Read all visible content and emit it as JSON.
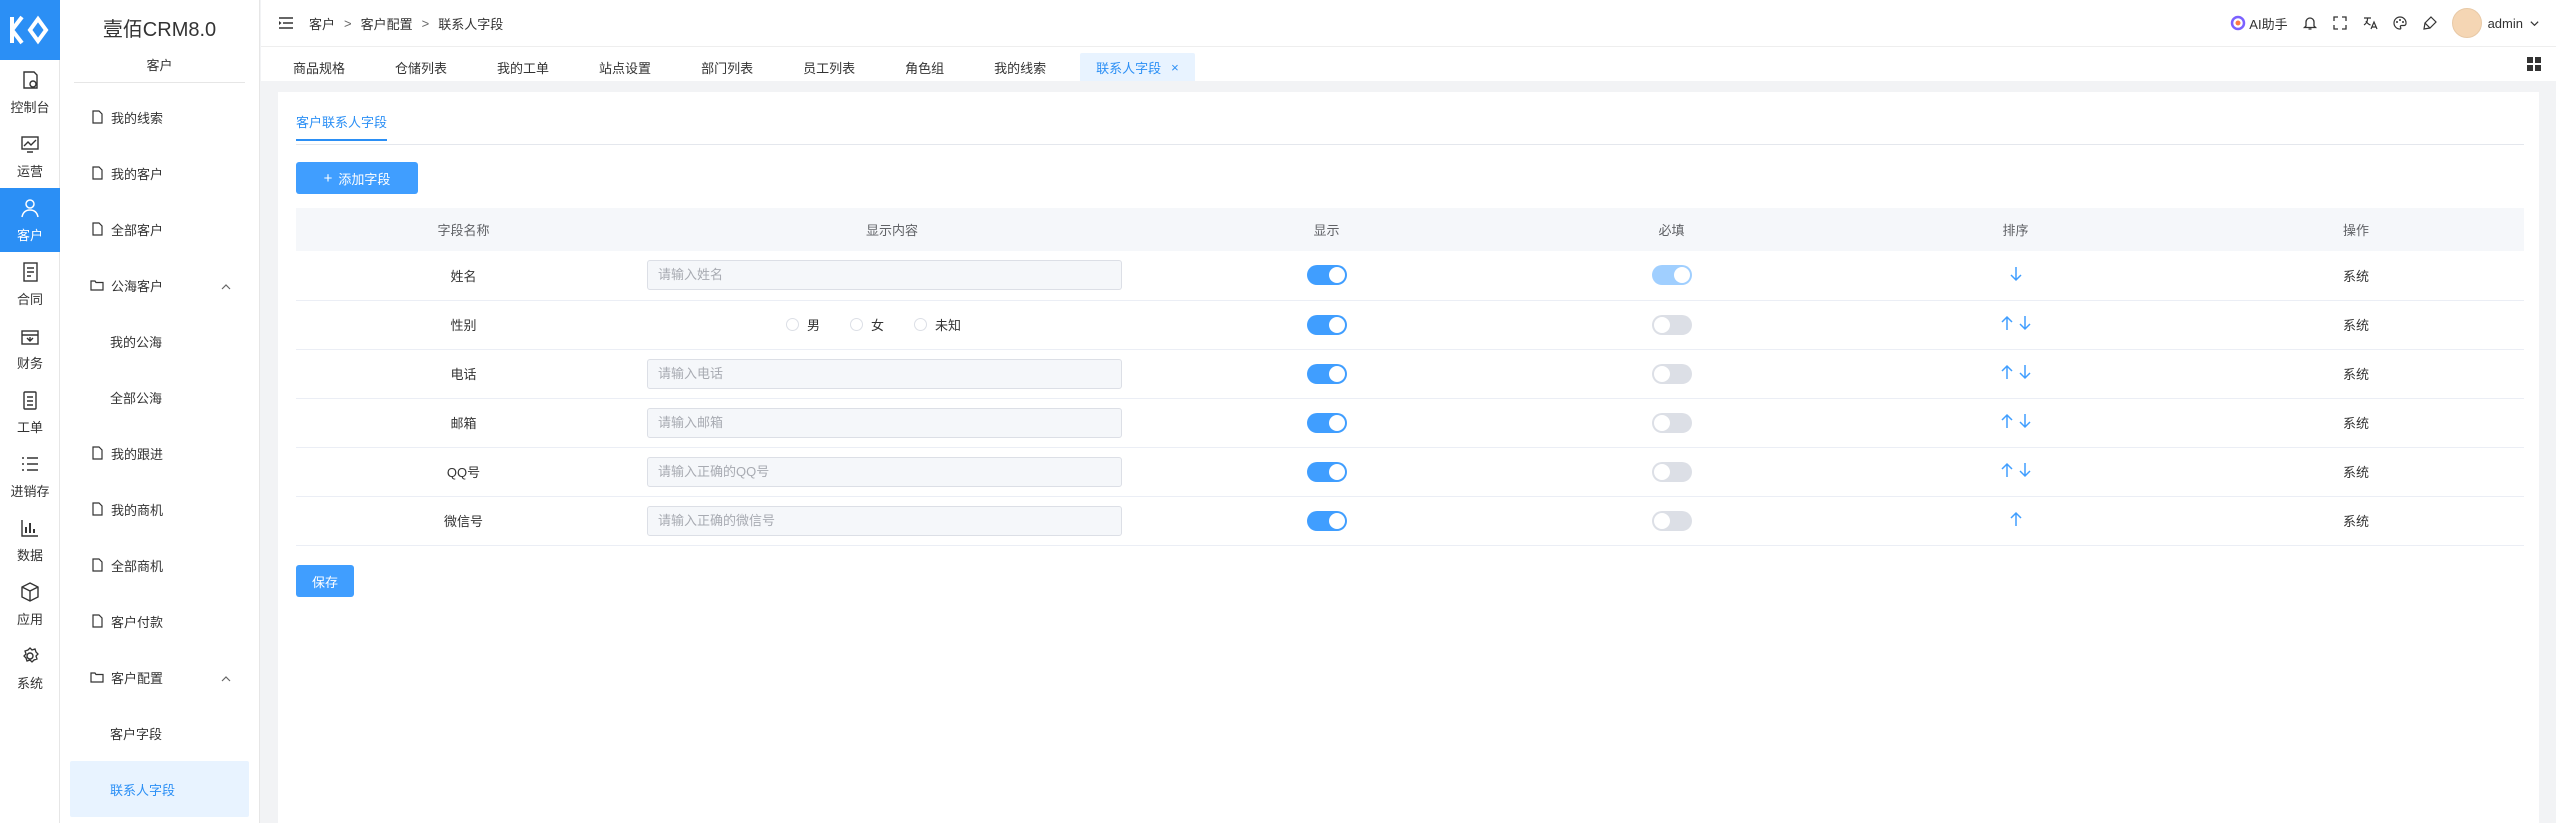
{
  "app": {
    "title": "壹佰CRM8.0",
    "module": "客户"
  },
  "rail": [
    {
      "label": "控制台",
      "icon": "dashboard-icon",
      "active": false
    },
    {
      "label": "运营",
      "icon": "chart-icon",
      "active": false
    },
    {
      "label": "客户",
      "icon": "user-icon",
      "active": true
    },
    {
      "label": "合同",
      "icon": "contract-icon",
      "active": false
    },
    {
      "label": "财务",
      "icon": "finance-icon",
      "active": false
    },
    {
      "label": "工单",
      "icon": "ticket-icon",
      "active": false
    },
    {
      "label": "进销存",
      "icon": "list-icon",
      "active": false
    },
    {
      "label": "数据",
      "icon": "bar-chart-icon",
      "active": false
    },
    {
      "label": "应用",
      "icon": "cube-icon",
      "active": false
    },
    {
      "label": "系统",
      "icon": "settings-icon",
      "active": false
    }
  ],
  "sidebar": {
    "items": [
      {
        "label": "我的线索",
        "type": "page"
      },
      {
        "label": "我的客户",
        "type": "page"
      },
      {
        "label": "全部客户",
        "type": "page"
      },
      {
        "label": "公海客户",
        "type": "folder"
      },
      {
        "label": "我的公海",
        "type": "child"
      },
      {
        "label": "全部公海",
        "type": "child"
      },
      {
        "label": "我的跟进",
        "type": "page"
      },
      {
        "label": "我的商机",
        "type": "page"
      },
      {
        "label": "全部商机",
        "type": "page"
      },
      {
        "label": "客户付款",
        "type": "page"
      },
      {
        "label": "客户配置",
        "type": "folder"
      },
      {
        "label": "客户字段",
        "type": "child"
      },
      {
        "label": "联系人字段",
        "type": "child-active"
      }
    ]
  },
  "header": {
    "breadcrumb": [
      "客户",
      "客户配置",
      "联系人字段"
    ],
    "ai_label": "AI助手",
    "user": "admin"
  },
  "tabs": [
    "商品规格",
    "仓储列表",
    "我的工单",
    "站点设置",
    "部门列表",
    "员工列表",
    "角色组",
    "我的线索",
    "联系人字段"
  ],
  "main": {
    "subtab": "客户联系人字段",
    "add_button": "添加字段",
    "save_button": "保存",
    "columns": [
      "字段名称",
      "显示内容",
      "显示",
      "必填",
      "排序",
      "操作"
    ],
    "rows": [
      {
        "name": "姓名",
        "kind": "input",
        "placeholder": "请输入姓名",
        "show": true,
        "required": true,
        "required_disabled": true,
        "sort": [
          "down"
        ],
        "op": "系统"
      },
      {
        "name": "性别",
        "kind": "radio",
        "options": [
          "男",
          "女",
          "未知"
        ],
        "show": true,
        "required": false,
        "sort": [
          "up",
          "down"
        ],
        "op": "系统"
      },
      {
        "name": "电话",
        "kind": "input",
        "placeholder": "请输入电话",
        "show": true,
        "required": false,
        "sort": [
          "up",
          "down"
        ],
        "op": "系统"
      },
      {
        "name": "邮箱",
        "kind": "input",
        "placeholder": "请输入邮箱",
        "show": true,
        "required": false,
        "sort": [
          "up",
          "down"
        ],
        "op": "系统"
      },
      {
        "name": "QQ号",
        "kind": "input",
        "placeholder": "请输入正确的QQ号",
        "show": true,
        "required": false,
        "sort": [
          "up",
          "down"
        ],
        "op": "系统"
      },
      {
        "name": "微信号",
        "kind": "input",
        "placeholder": "请输入正确的微信号",
        "show": true,
        "required": false,
        "sort": [
          "up"
        ],
        "op": "系统"
      }
    ]
  },
  "colors": {
    "primary": "#409eff",
    "brand": "#2b8ff5"
  }
}
